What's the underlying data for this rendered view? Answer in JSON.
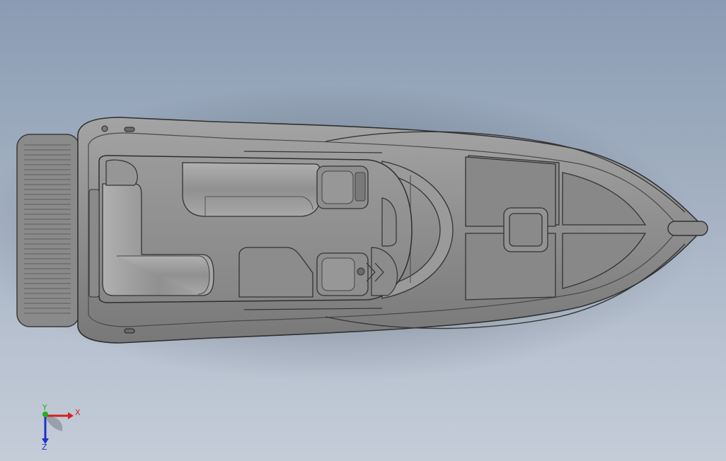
{
  "triad": {
    "x_label": "X",
    "y_label": "Y",
    "z_label": "Z",
    "colors": {
      "x_axis": "#d42020",
      "y_axis": "#20b020",
      "z_axis": "#2030c8"
    }
  },
  "colors": {
    "background_top": "#8a9cb3",
    "background_bottom": "#c4ccd8",
    "hull_fill": "#8c8c8c",
    "hull_edge": "#3a3a3a"
  }
}
